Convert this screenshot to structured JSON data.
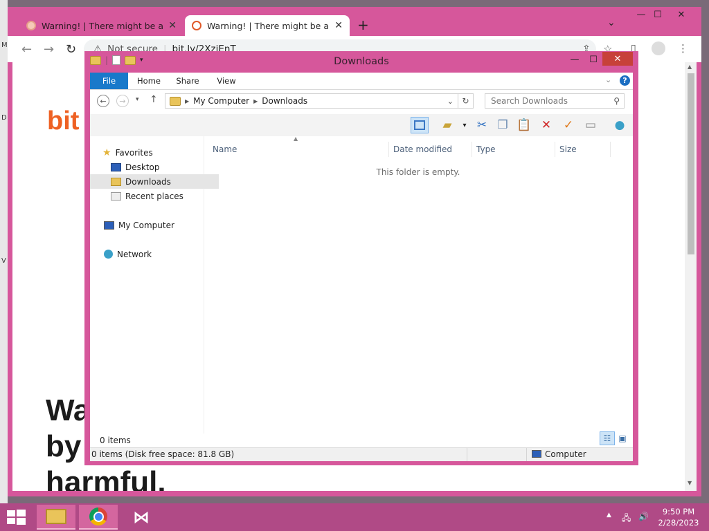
{
  "browser": {
    "tabs": [
      {
        "title": "Warning! | There might be a probl",
        "active": false
      },
      {
        "title": "Warning! | There might be a probl",
        "active": true
      }
    ],
    "new_tab_icon": "+",
    "tab_search_icon": "⌄",
    "window_controls": {
      "minimize": "—",
      "maximize": "☐",
      "close": "✕"
    },
    "nav": {
      "back": "←",
      "forward": "→",
      "reload": "↻"
    },
    "security_label": "Not secure",
    "url": "bit.ly/2XziEnT",
    "page": {
      "logo_text": "bit",
      "heading_lines": [
        "Wa",
        "by",
        "harmful."
      ]
    }
  },
  "explorer": {
    "title": "Downloads",
    "ribbon_tabs": [
      "File",
      "Home",
      "Share",
      "View"
    ],
    "help": "?",
    "breadcrumb": [
      "My Computer",
      "Downloads"
    ],
    "search_placeholder": "Search Downloads",
    "nav_pane": {
      "favorites": "Favorites",
      "favorites_items": [
        "Desktop",
        "Downloads",
        "Recent places"
      ],
      "computer": "My Computer",
      "network": "Network"
    },
    "columns": [
      "Name",
      "Date modified",
      "Type",
      "Size"
    ],
    "empty_message": "This folder is empty.",
    "item_count": "0 items",
    "status_left": "0 items (Disk free space: 81.8 GB)",
    "status_right": "Computer",
    "selected_nav_item": "Downloads",
    "accent_color": "#1979ca"
  },
  "desktop_edge_glyphs": [
    "M",
    "D",
    "V"
  ],
  "taskbar": {
    "time": "9:50 PM",
    "date": "2/28/2023",
    "apps": [
      "file-explorer",
      "chrome",
      "visual-studio"
    ],
    "color": "#b04a86"
  }
}
